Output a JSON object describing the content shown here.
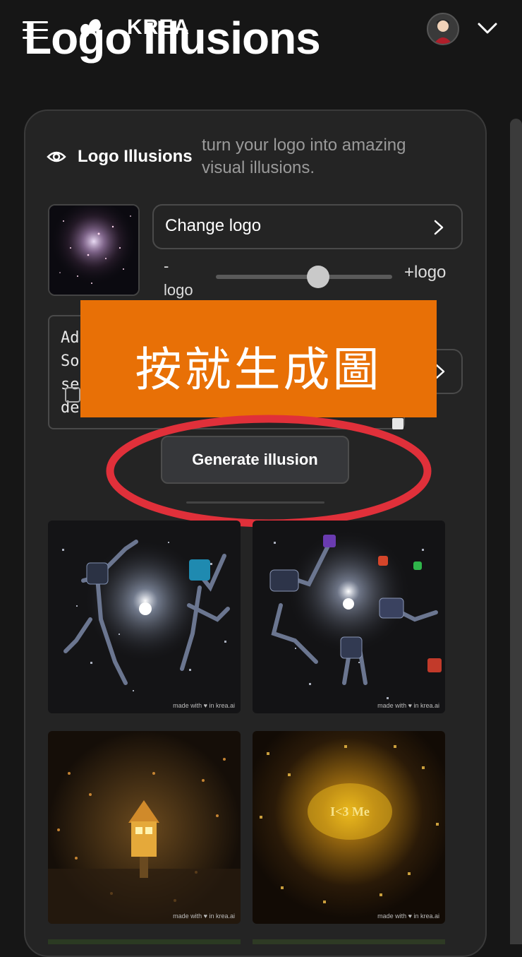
{
  "header": {
    "brand": "KREA",
    "overlay_title": "Logo Illusions"
  },
  "panel": {
    "title": "Logo Illusions",
    "subtitle": "turn your logo into amazing visual illusions.",
    "change_logo_label": "Change logo",
    "slider_min_label": "-\nlogo",
    "slider_max_label": "+logo",
    "slider_value_fraction": 0.58,
    "prompt_text": "Ad\nSo\nse\nde",
    "generate_button": "Generate illusion"
  },
  "annotation": {
    "banner_text": "按就生成圖",
    "banner_color": "#e87006",
    "ring_color": "#e0303a"
  },
  "results": {
    "watermark": "made with ♥ in krea.ai",
    "tiles": [
      {
        "icon": "robot-constellation-image"
      },
      {
        "icon": "robot-constellation-image"
      },
      {
        "icon": "glowing-house-image"
      },
      {
        "icon": "golden-city-text-image",
        "overlay_text": "I<3 Me"
      }
    ]
  },
  "colors": {
    "background": "#161616",
    "panel": "#242424",
    "button": "#36373a"
  }
}
